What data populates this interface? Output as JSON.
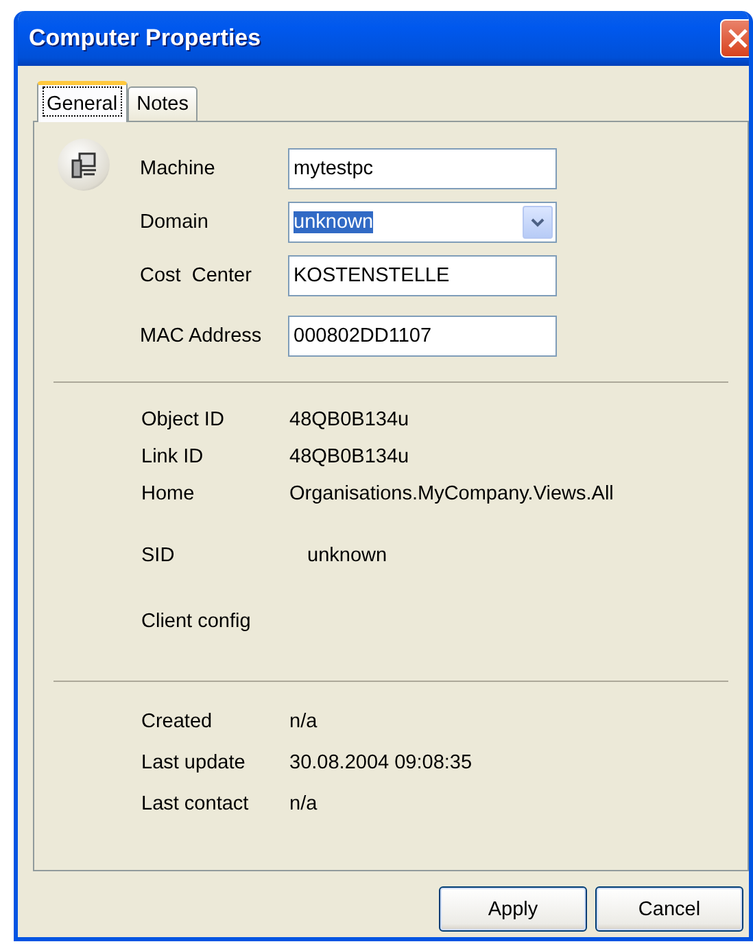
{
  "window": {
    "title": "Computer Properties"
  },
  "tabs": [
    {
      "label": "General",
      "selected": true
    },
    {
      "label": "Notes",
      "selected": false
    }
  ],
  "fields": [
    {
      "label": "Machine",
      "kind": "text",
      "value": "mytestpc"
    },
    {
      "label": "Domain",
      "kind": "dropdown",
      "value": "unknown",
      "text_selected": true
    },
    {
      "label": "Cost  Center",
      "kind": "text",
      "value": "KOSTENSTELLE"
    },
    {
      "label": "MAC Address",
      "kind": "text",
      "value": "000802DD1107"
    }
  ],
  "identity": [
    {
      "label": "Object ID",
      "value": "48QB0B134u"
    },
    {
      "label": "Link ID",
      "value": "48QB0B134u"
    },
    {
      "label": "Home",
      "value": "Organisations.MyCompany.Views.All"
    },
    {
      "label": "SID",
      "value": "unknown"
    },
    {
      "label": "Client config"
    }
  ],
  "dates": [
    {
      "label": "Created",
      "value": "n/a"
    },
    {
      "label": "Last update",
      "value": "30.08.2004 09:08:35"
    },
    {
      "label": "Last contact",
      "value": "n/a"
    }
  ],
  "buttons": [
    "Apply",
    "Cancel"
  ]
}
